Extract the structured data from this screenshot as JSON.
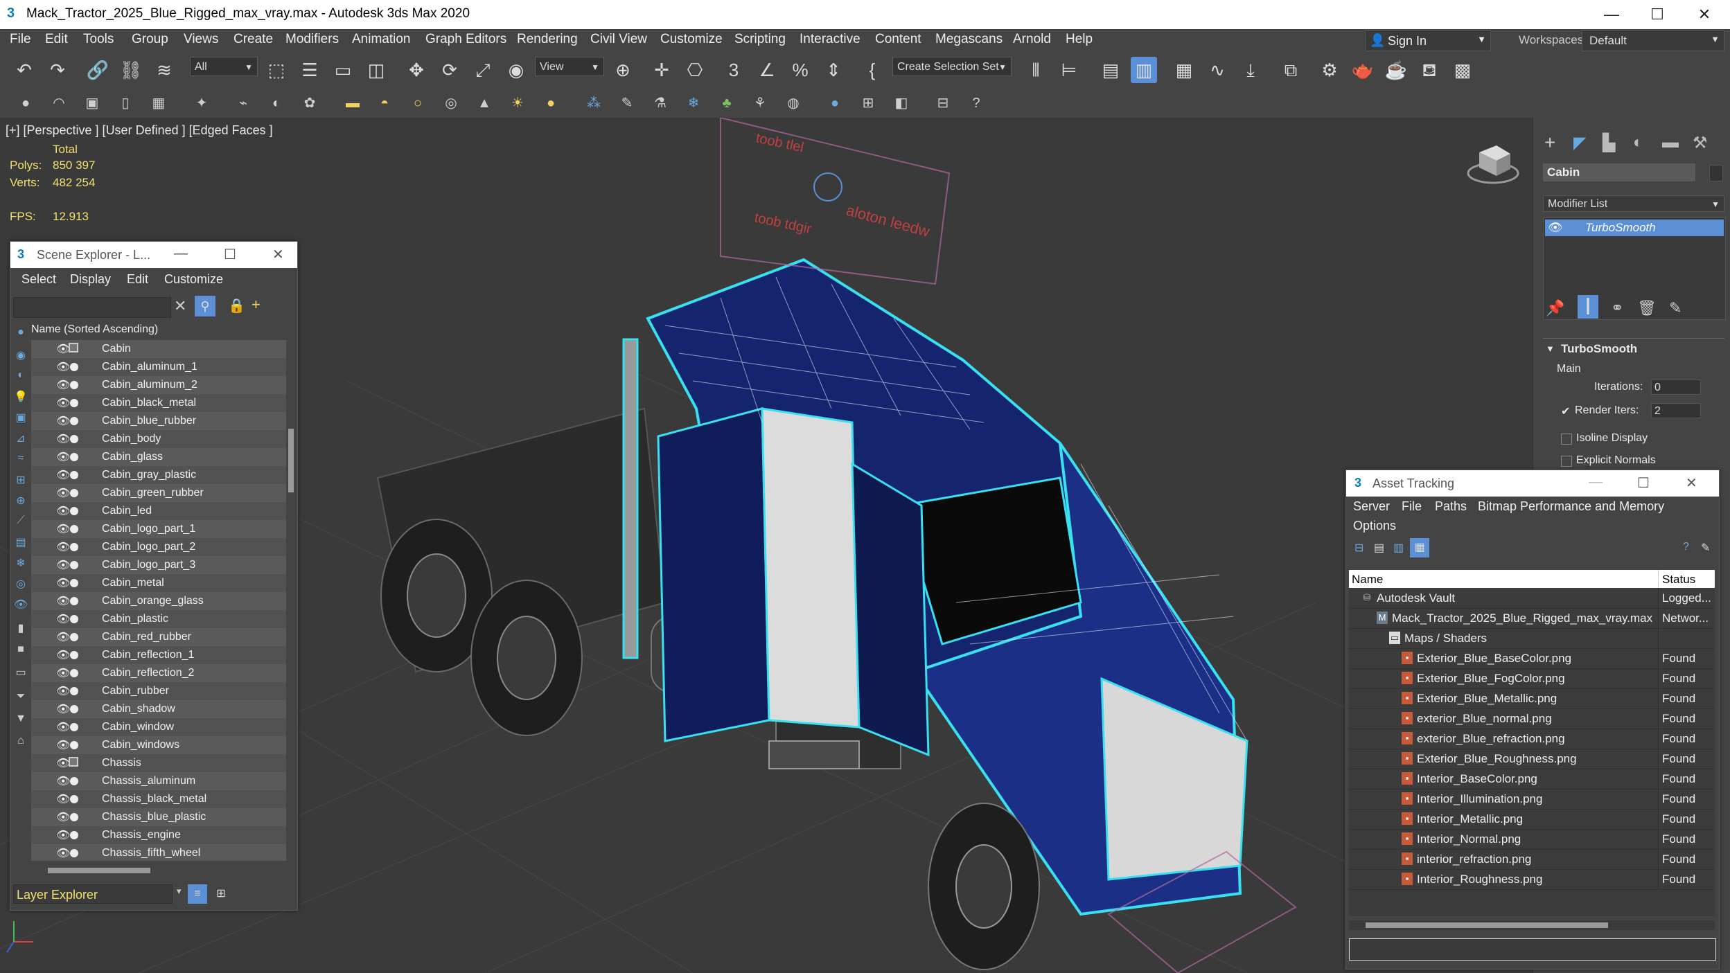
{
  "app": {
    "title": "Mack_Tractor_2025_Blue_Rigged_max_vray.max - Autodesk 3ds Max 2020",
    "icon": "3"
  },
  "menu": [
    "File",
    "Edit",
    "Tools",
    "Group",
    "Views",
    "Create",
    "Modifiers",
    "Animation",
    "Graph Editors",
    "Rendering",
    "Civil View",
    "Customize",
    "Scripting",
    "Interactive",
    "Content",
    "Megascans",
    "Arnold",
    "Help"
  ],
  "account": {
    "sign_in": "Sign In"
  },
  "workspaces": {
    "label": "Workspaces:",
    "value": "Default"
  },
  "toolbar": {
    "selection_filter": "All",
    "ref_coord": "View",
    "named_selection": "Create Selection Set"
  },
  "viewport": {
    "label": "[+] [Perspective ] [User Defined ] [Edged Faces ]",
    "stats": {
      "total_label": "Total",
      "polys_label": "Polys:",
      "polys_value": "850 397",
      "verts_label": "Verts:",
      "verts_value": "482 254",
      "fps_label": "FPS:",
      "fps_value": "12.913"
    },
    "scene_text": [
      "toob tlel",
      "toob tdgir",
      "aloton leedw"
    ]
  },
  "scene_explorer": {
    "title": "Scene Explorer - L...",
    "menu": [
      "Select",
      "Display",
      "Edit",
      "Customize"
    ],
    "column_header": "Name (Sorted Ascending)",
    "items": [
      "Cabin",
      "Cabin_aluminum_1",
      "Cabin_aluminum_2",
      "Cabin_black_metal",
      "Cabin_blue_rubber",
      "Cabin_body",
      "Cabin_glass",
      "Cabin_gray_plastic",
      "Cabin_green_rubber",
      "Cabin_led",
      "Cabin_logo_part_1",
      "Cabin_logo_part_2",
      "Cabin_logo_part_3",
      "Cabin_metal",
      "Cabin_orange_glass",
      "Cabin_plastic",
      "Cabin_red_rubber",
      "Cabin_reflection_1",
      "Cabin_reflection_2",
      "Cabin_rubber",
      "Cabin_shadow",
      "Cabin_window",
      "Cabin_windows",
      "Chassis",
      "Chassis_aluminum",
      "Chassis_black_metal",
      "Chassis_blue_plastic",
      "Chassis_engine",
      "Chassis_fifth_wheel"
    ],
    "footer": "Layer Explorer"
  },
  "command_panel": {
    "object_name": "Cabin",
    "modifier_list": "Modifier List",
    "stack_item": "TurboSmooth",
    "rollout_title": "TurboSmooth",
    "section": "Main",
    "iterations_label": "Iterations:",
    "iterations_value": "0",
    "render_iters_label": "Render Iters:",
    "render_iters_value": "2",
    "isoline_label": "Isoline Display",
    "explicit_label": "Explicit Normals"
  },
  "asset_tracking": {
    "title": "Asset Tracking",
    "menu": [
      "Server",
      "File",
      "Paths",
      "Bitmap Performance and Memory",
      "Options"
    ],
    "columns": {
      "name": "Name",
      "status": "Status"
    },
    "rows": [
      {
        "name": "Autodesk Vault",
        "status": "Logged...",
        "icon": "vault-icon"
      },
      {
        "name": "Mack_Tractor_2025_Blue_Rigged_max_vray.max",
        "status": "Networ...",
        "icon": "max-file-icon"
      },
      {
        "name": "Maps / Shaders",
        "status": "",
        "icon": "folder-icon"
      },
      {
        "name": "Exterior_Blue_BaseColor.png",
        "status": "Found",
        "icon": "image-file-icon"
      },
      {
        "name": "Exterior_Blue_FogColor.png",
        "status": "Found",
        "icon": "image-file-icon"
      },
      {
        "name": "Exterior_Blue_Metallic.png",
        "status": "Found",
        "icon": "image-file-icon"
      },
      {
        "name": "exterior_Blue_normal.png",
        "status": "Found",
        "icon": "image-file-icon"
      },
      {
        "name": "exterior_Blue_refraction.png",
        "status": "Found",
        "icon": "image-file-icon"
      },
      {
        "name": "Exterior_Blue_Roughness.png",
        "status": "Found",
        "icon": "image-file-icon"
      },
      {
        "name": "Interior_BaseColor.png",
        "status": "Found",
        "icon": "image-file-icon"
      },
      {
        "name": "Interior_Illumination.png",
        "status": "Found",
        "icon": "image-file-icon"
      },
      {
        "name": "Interior_Metallic.png",
        "status": "Found",
        "icon": "image-file-icon"
      },
      {
        "name": "Interior_Normal.png",
        "status": "Found",
        "icon": "image-file-icon"
      },
      {
        "name": "interior_refraction.png",
        "status": "Found",
        "icon": "image-file-icon"
      },
      {
        "name": "Interior_Roughness.png",
        "status": "Found",
        "icon": "image-file-icon"
      }
    ]
  },
  "colors": {
    "accent": "#5b8fd6",
    "stats_text": "#f2e070",
    "selection_outline": "#38e0f0",
    "truck_blue": "#14246e"
  }
}
